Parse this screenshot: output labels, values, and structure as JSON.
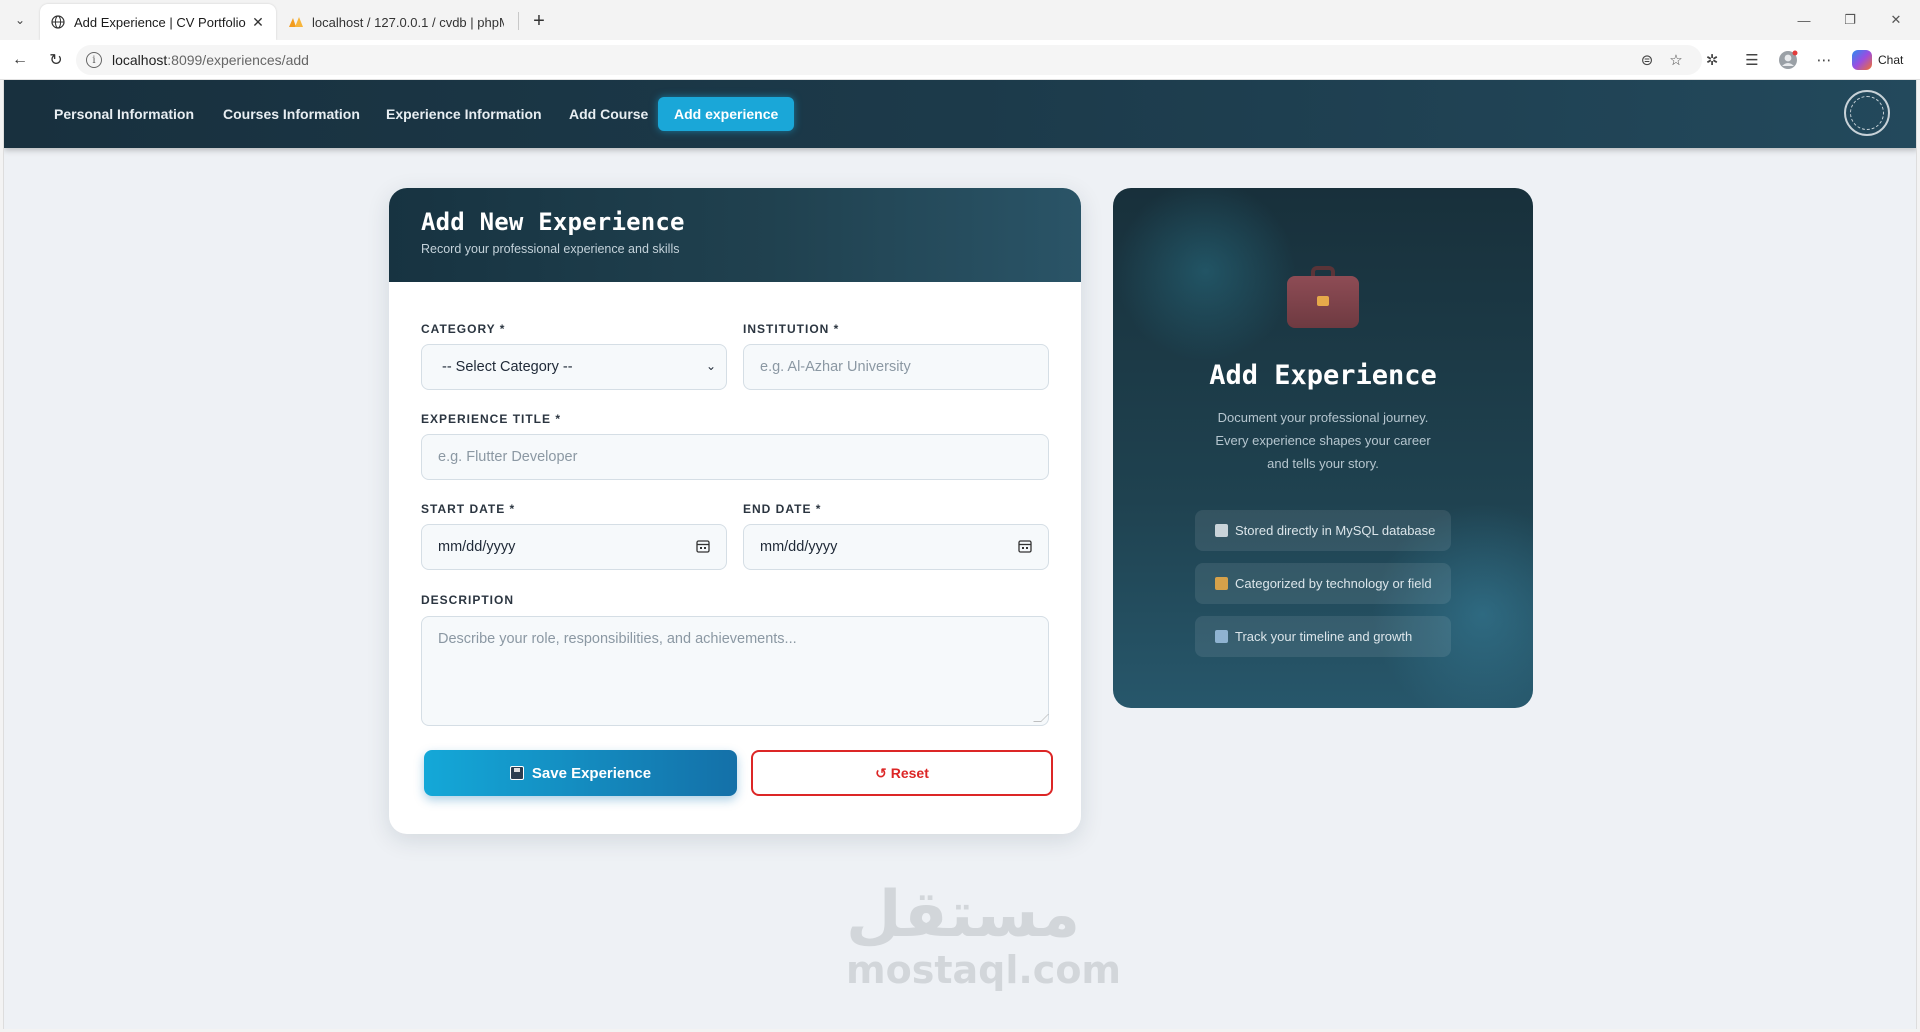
{
  "browser": {
    "tabs": [
      {
        "title": "Add Experience | CV Portfolio",
        "active": true
      },
      {
        "title": "localhost / 127.0.0.1 / cvdb | phpM",
        "active": false
      }
    ],
    "url_host": "localhost",
    "url_path": ":8099/experiences/add",
    "chat_label": "Chat"
  },
  "nav": {
    "items": [
      {
        "label": "Personal Information"
      },
      {
        "label": "Courses Information"
      },
      {
        "label": "Experience Information"
      },
      {
        "label": "Add Course"
      },
      {
        "label": "Add experience",
        "active": true
      }
    ]
  },
  "form": {
    "title": "Add New Experience",
    "subtitle": "Record your professional experience and skills",
    "category_label": "CATEGORY *",
    "category_value": "-- Select Category --",
    "institution_label": "INSTITUTION *",
    "institution_placeholder": "e.g. Al-Azhar University",
    "title_label": "EXPERIENCE TITLE *",
    "title_placeholder": "e.g. Flutter Developer",
    "start_label": "START DATE *",
    "start_value": "mm/dd/yyyy",
    "end_label": "END DATE *",
    "end_value": "mm/dd/yyyy",
    "description_label": "DESCRIPTION",
    "description_placeholder": "Describe your role, responsibilities, and achievements...",
    "save_label": "Save Experience",
    "reset_label": "↺ Reset"
  },
  "side": {
    "title": "Add Experience",
    "text": "Document your professional journey. Every experience shapes your career and tells your story.",
    "features": [
      {
        "label": "Stored directly in MySQL database",
        "icon": "checkbox-icon",
        "color": "#c9d3d9"
      },
      {
        "label": "Categorized by technology or field",
        "icon": "folder-icon",
        "color": "#d6a14a"
      },
      {
        "label": "Track your timeline and growth",
        "icon": "calendar-icon",
        "color": "#8fb3d1"
      }
    ]
  },
  "watermark": {
    "arabic": "مستقل",
    "latin": "mostaql.com"
  },
  "colors": {
    "accent": "#1aa7d8",
    "danger": "#dc2626",
    "header_dark": "#18303e"
  }
}
